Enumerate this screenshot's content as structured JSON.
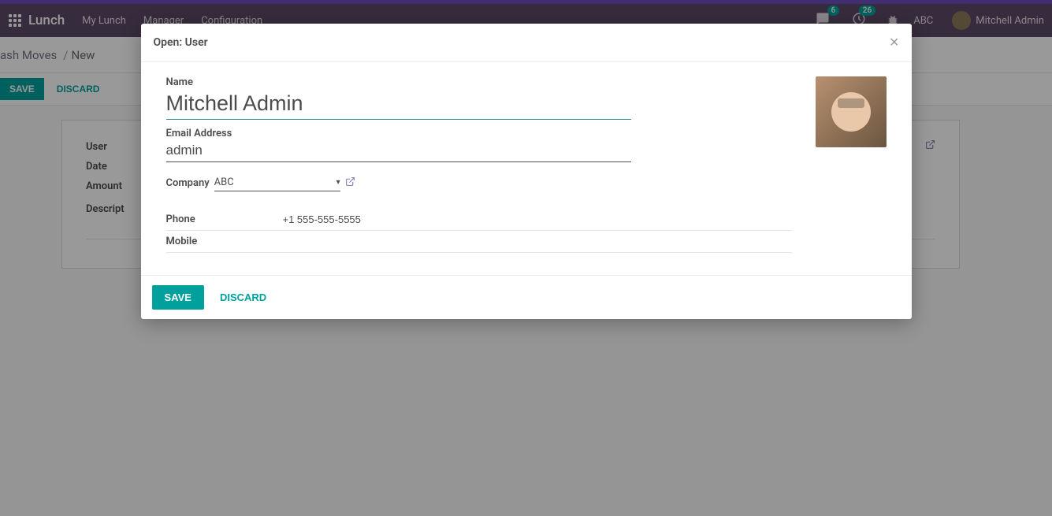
{
  "topbar": {
    "brand": "Lunch",
    "nav": [
      "My Lunch",
      "Manager",
      "Configuration"
    ],
    "badge1": "6",
    "badge2": "26",
    "company": "ABC",
    "user": "Mitchell Admin"
  },
  "breadcrumb": {
    "main": "ash Moves",
    "sep": "/",
    "current": "New"
  },
  "bg_actions": {
    "save": "SAVE",
    "discard": "DISCARD"
  },
  "bg_form": {
    "labels": {
      "user": "User",
      "date": "Date",
      "amount": "Amount",
      "description": "Descript"
    }
  },
  "modal": {
    "title": "Open: User",
    "name_label": "Name",
    "name_value": "Mitchell Admin",
    "email_label": "Email Address",
    "email_value": "admin",
    "company_label": "Company",
    "company_value": "ABC",
    "phone_label": "Phone",
    "phone_value": "+1 555-555-5555",
    "mobile_label": "Mobile",
    "mobile_value": "",
    "save": "SAVE",
    "discard": "DISCARD"
  }
}
